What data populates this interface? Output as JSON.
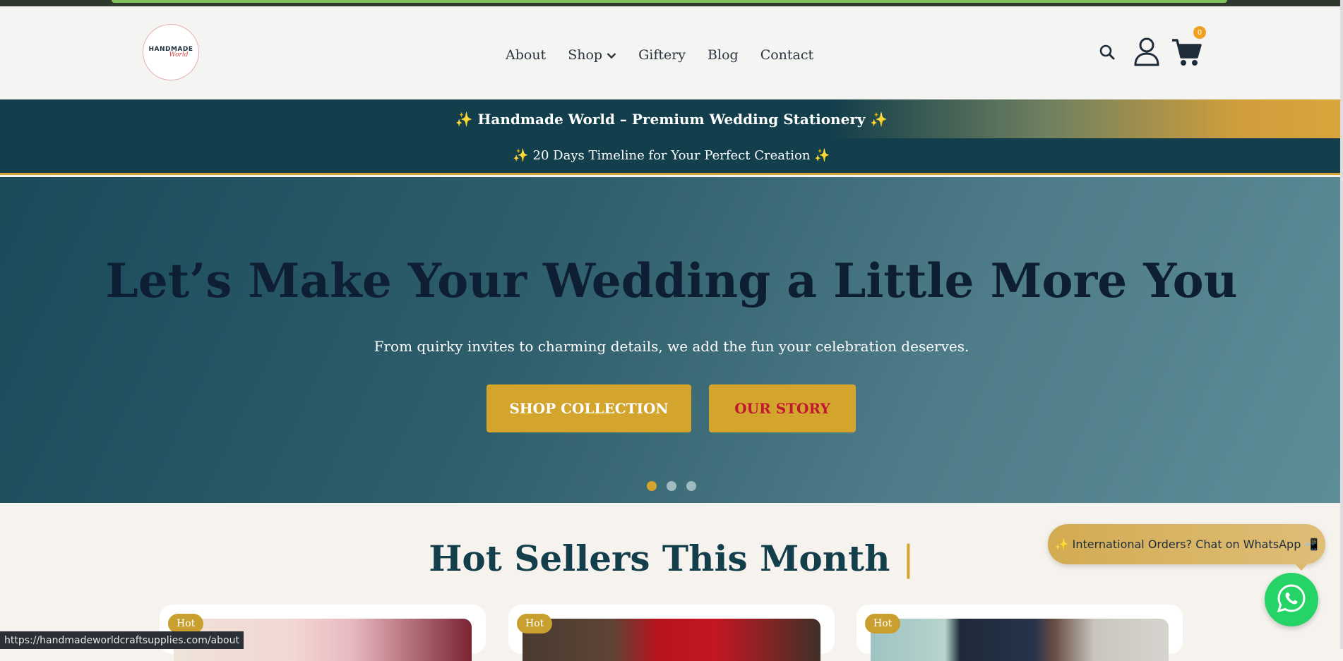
{
  "header": {
    "logo_text": "HANDMADE",
    "logo_script": "World",
    "nav": [
      {
        "label": "About"
      },
      {
        "label": "Shop"
      },
      {
        "label": "Giftery"
      },
      {
        "label": "Blog"
      },
      {
        "label": "Contact"
      }
    ],
    "cart_count": "0"
  },
  "announcements": {
    "primary": "✨ Handmade World – Premium Wedding Stationery ✨",
    "secondary": "✨ 20 Days Timeline for Your Perfect Creation ✨"
  },
  "hero": {
    "title": "Let’s Make Your Wedding a Little More You",
    "subtitle": "From quirky invites to charming details, we add the fun your celebration deserves.",
    "primary_button": "SHOP COLLECTION",
    "secondary_button": "OUR STORY",
    "active_slide": 1
  },
  "hot_sellers": {
    "title": "Hot Sellers This Month",
    "cursor": "|",
    "cards": [
      {
        "tag": "Hot"
      },
      {
        "tag": "Hot"
      },
      {
        "tag": "Hot"
      }
    ]
  },
  "whatsapp": {
    "cta": "✨ International Orders? Chat on WhatsApp 📲"
  },
  "status_bar": {
    "url": "https://handmadeworldcraftsupplies.com/about"
  },
  "colors": {
    "brand_teal": "#133e4b",
    "accent_gold": "#d4a52c",
    "whatsapp_green": "#25d366"
  }
}
